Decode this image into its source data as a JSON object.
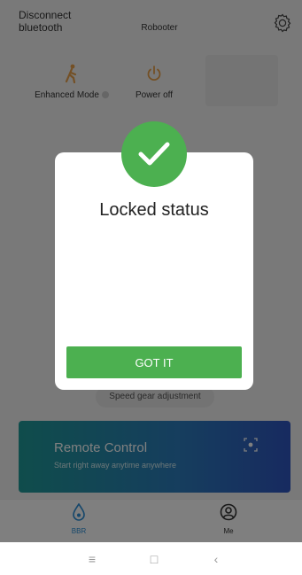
{
  "header": {
    "disconnect_label": "Disconnect bluetooth",
    "app_title_faint": "",
    "app_title": "Robooter",
    "settings_icon": "gear-icon"
  },
  "modes": [
    {
      "label": "Enhanced Mode",
      "icon": "walking-person-icon",
      "color": "#e8a04a"
    },
    {
      "label": "Power off",
      "icon": "power-icon",
      "color": "#e8a04a"
    }
  ],
  "speed": {
    "label": "Speed gear adjustment"
  },
  "remote": {
    "title": "Remote Control",
    "subtitle": "Start right away anytime anywhere",
    "icon": "remote-target-icon"
  },
  "tabs": [
    {
      "label": "BBR",
      "icon": "droplet-icon",
      "active": true
    },
    {
      "label": "Me",
      "icon": "user-icon",
      "active": false
    }
  ],
  "dialog": {
    "title": "Locked status",
    "button_label": "GOT IT",
    "icon": "check-icon",
    "accent_color": "#4cb050"
  },
  "system_nav": {
    "menu_icon": "≡",
    "home_icon": "□",
    "back_icon": "‹"
  }
}
